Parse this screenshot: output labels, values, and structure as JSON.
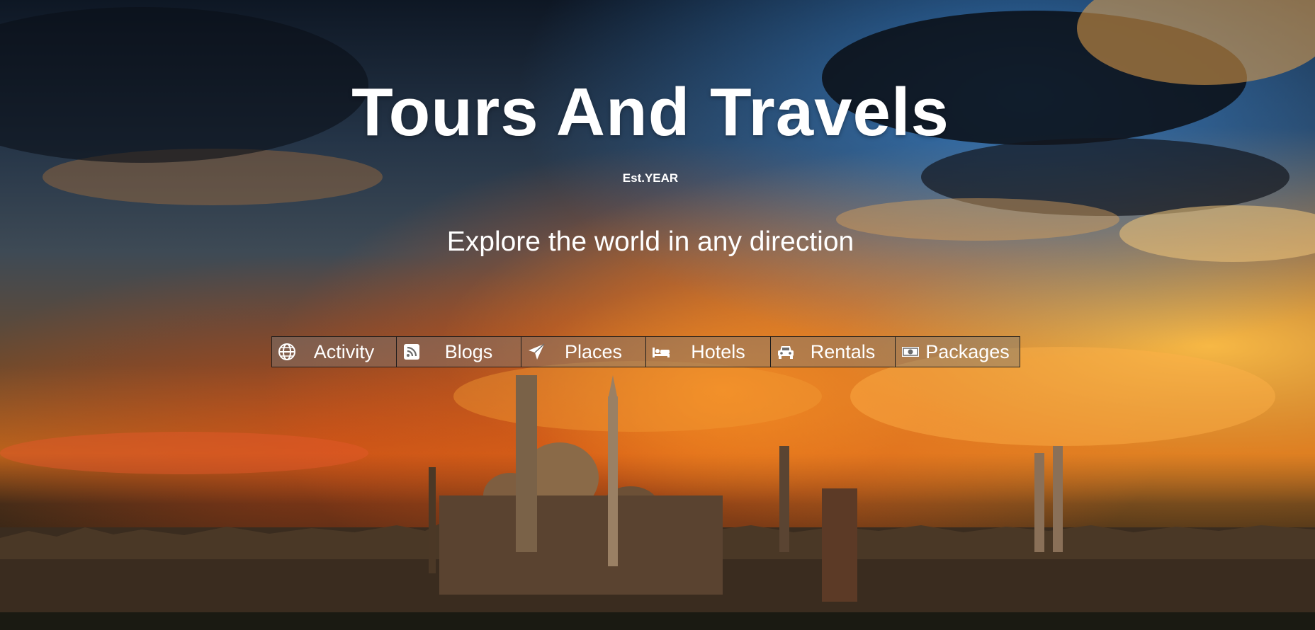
{
  "hero": {
    "title": "Tours And Travels",
    "established": "Est.YEAR",
    "tagline": "Explore the world in any direction"
  },
  "nav": {
    "items": [
      {
        "label": "Activity",
        "icon": "globe-icon"
      },
      {
        "label": "Blogs",
        "icon": "rss-icon"
      },
      {
        "label": "Places",
        "icon": "paper-plane-icon"
      },
      {
        "label": "Hotels",
        "icon": "bed-icon"
      },
      {
        "label": "Rentals",
        "icon": "car-icon"
      },
      {
        "label": "Packages",
        "icon": "money-icon"
      }
    ]
  },
  "colors": {
    "text": "#ffffff",
    "nav_background": "rgba(120,120,120,0.45)",
    "nav_border": "#141414"
  }
}
